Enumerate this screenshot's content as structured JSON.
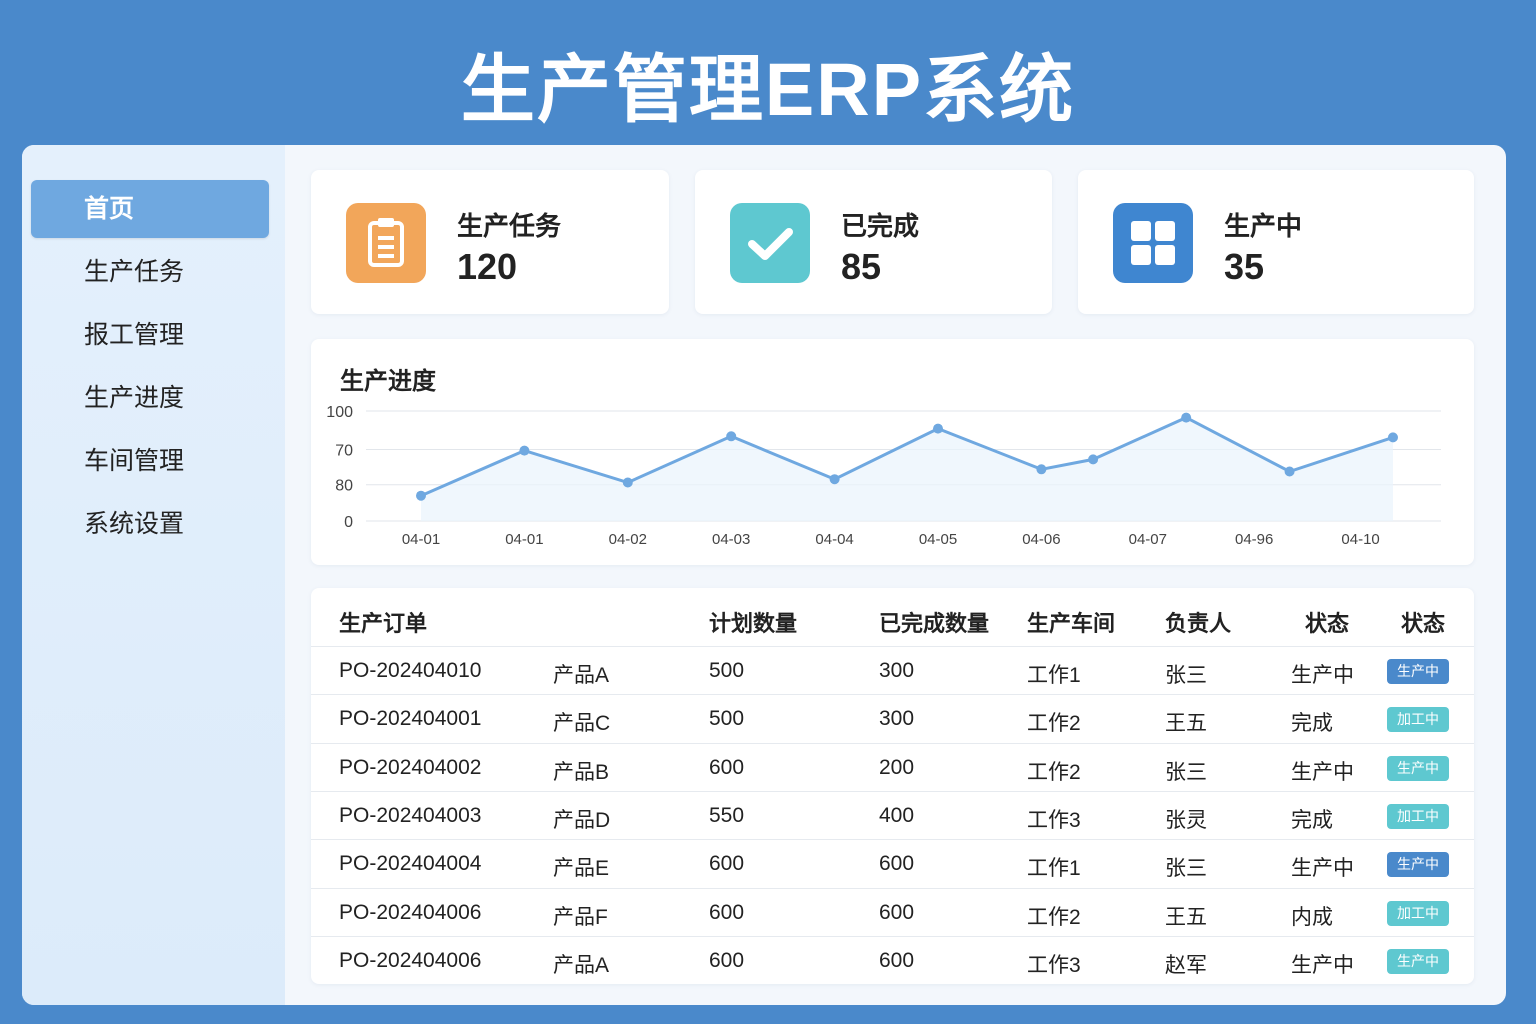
{
  "title": "生产管理ERP系统",
  "sidebar": {
    "items": [
      {
        "label": "首页",
        "active": true
      },
      {
        "label": "生产任务"
      },
      {
        "label": "报工管理"
      },
      {
        "label": "生产进度"
      },
      {
        "label": "车间管理"
      },
      {
        "label": "系统设置"
      }
    ]
  },
  "stats": [
    {
      "label": "生产任务",
      "value": "120",
      "icon": "clipboard-icon",
      "color": "#f2a65a"
    },
    {
      "label": "已完成",
      "value": "85",
      "icon": "check-icon",
      "color": "#5ec8d0"
    },
    {
      "label": "生产中",
      "value": "35",
      "icon": "grid-icon",
      "color": "#3f86d0"
    }
  ],
  "chart_data": {
    "type": "line",
    "title": "生产进度",
    "x_labels": [
      "04-01",
      "04-01",
      "04-02",
      "04-03",
      "04-04",
      "04-05",
      "04-06",
      "04-07",
      "04-96",
      "04-10"
    ],
    "y_ticks": [
      {
        "value": 0,
        "label": "0"
      },
      {
        "value": 33,
        "label": "80"
      },
      {
        "value": 65,
        "label": "70"
      },
      {
        "value": 100,
        "label": "100"
      }
    ],
    "ylim": [
      0,
      100
    ],
    "points": [
      {
        "x": 0,
        "y": 23
      },
      {
        "x": 1,
        "y": 64
      },
      {
        "x": 2,
        "y": 35
      },
      {
        "x": 3,
        "y": 77
      },
      {
        "x": 4,
        "y": 38
      },
      {
        "x": 5,
        "y": 84
      },
      {
        "x": 6,
        "y": 47
      },
      {
        "x": 6.5,
        "y": 56
      },
      {
        "x": 7.4,
        "y": 94
      },
      {
        "x": 8.4,
        "y": 45
      },
      {
        "x": 9.4,
        "y": 76
      }
    ],
    "color": "#6fa8e0"
  },
  "table": {
    "headers": [
      "生产订单",
      "",
      "计划数量",
      "已完成数量",
      "生产车间",
      "负责人",
      "状态",
      "状态"
    ],
    "rows": [
      [
        "PO-202404010",
        "产品A",
        "500",
        "300",
        "工作1",
        "张三",
        "生产中",
        "生产中",
        "#4a89cb"
      ],
      [
        "PO-202404001",
        "产品C",
        "500",
        "300",
        "工作2",
        "王五",
        "完成",
        "加工中",
        "#5ec8d0"
      ],
      [
        "PO-202404002",
        "产品B",
        "600",
        "200",
        "工作2",
        "张三",
        "生产中",
        "生产中",
        "#5ec8d0"
      ],
      [
        "PO-202404003",
        "产品D",
        "550",
        "400",
        "工作3",
        "张灵",
        "完成",
        "加工中",
        "#5ec8d0"
      ],
      [
        "PO-202404004",
        "产品E",
        "600",
        "600",
        "工作1",
        "张三",
        "生产中",
        "生产中",
        "#4a89cb"
      ],
      [
        "PO-202404006",
        "产品F",
        "600",
        "600",
        "工作2",
        "王五",
        "内成",
        "加工中",
        "#5ec8d0"
      ],
      [
        "PO-202404006",
        "产品A",
        "600",
        "600",
        "工作3",
        "赵军",
        "生产中",
        "生产中",
        "#5ec8d0"
      ]
    ]
  }
}
